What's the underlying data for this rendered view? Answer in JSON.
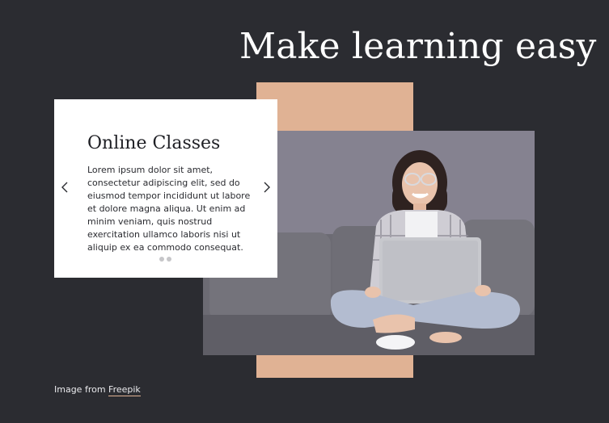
{
  "hero": {
    "title": "Make learning easy"
  },
  "card": {
    "title": "Online Classes",
    "body": "Lorem ipsum dolor sit amet, consectetur adipiscing elit, sed do eiusmod tempor incididunt ut labore et dolore magna aliqua. Ut enim ad minim veniam, quis nostrud exercitation ullamco laboris nisi ut aliquip ex ea commodo consequat.",
    "slide_count": 2
  },
  "credit": {
    "prefix": "Image from",
    "link_label": "Freepik"
  },
  "colors": {
    "background": "#2b2c31",
    "accent": "#e0b294",
    "card": "#ffffff"
  },
  "icons": {
    "prev": "chevron-left-icon",
    "next": "chevron-right-icon"
  }
}
